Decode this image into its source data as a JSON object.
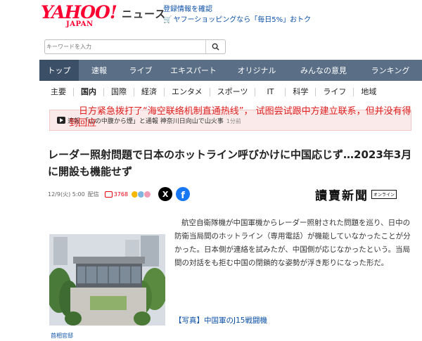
{
  "header": {
    "logo_main": "YAHOO!",
    "logo_sub": "JAPAN",
    "service": "ニュース",
    "link_register": "登録情報を確認",
    "link_shopping": "ヤフーショッピングなら「毎日5%」おトク"
  },
  "search": {
    "placeholder": "キーワードを入力"
  },
  "main_nav": [
    {
      "label": "トップ",
      "active": true
    },
    {
      "label": "速報"
    },
    {
      "label": "ライブ"
    },
    {
      "label": "エキスパート"
    },
    {
      "label": "オリジナル"
    },
    {
      "label": "みんなの意見"
    },
    {
      "label": "ランキング"
    }
  ],
  "sub_nav": [
    {
      "label": "主要"
    },
    {
      "label": "国内",
      "active": true
    },
    {
      "label": "国際"
    },
    {
      "label": "経済"
    },
    {
      "label": "エンタメ"
    },
    {
      "label": "スポーツ"
    },
    {
      "label": "IT"
    },
    {
      "label": "科学"
    },
    {
      "label": "ライフ"
    },
    {
      "label": "地域"
    }
  ],
  "breaking": {
    "text": "速報 「山の中腹から煙」と通報 神奈川日向山で山火事",
    "time": "1分前"
  },
  "overlay_annotation": "日方紧急拨打了“海空联络机制直通热线”， 试图尝试跟中方建立联系，但并没有得到回应",
  "article": {
    "title": "レーダー照射問題で日本のホットライン呼びかけに中国応じず…2023年3月に開設も機能せず",
    "date": "12/9(火) 5:00",
    "distribution": "配信",
    "comment_count": "3768",
    "publisher": "讀賣新聞",
    "publisher_tag": "オンライン",
    "body": "航空自衛隊機が中国軍機からレーダー照射された問題を巡り、日中の防衛当局間のホットライン（専用電話）が機能していなかったことが分かった。日本側が連絡を試みたが、中国側が応じなかったという。当局間の対話をも拒む中国の閉鎖的な姿勢が浮き彫りになった形だ。",
    "photo_link": "【写真】中国軍のJ15戦闘機",
    "photo_caption": "首相官邸"
  },
  "colors": {
    "yahoo_red": "#ff0033",
    "nav_bg": "#5a6f86",
    "nav_active": "#3b4f66",
    "link_blue": "#0b4fa8",
    "overlay_red": "#e02020"
  },
  "icons": [
    "cart-icon",
    "search-icon",
    "play-icon",
    "comment-icon",
    "x-icon",
    "facebook-icon"
  ]
}
